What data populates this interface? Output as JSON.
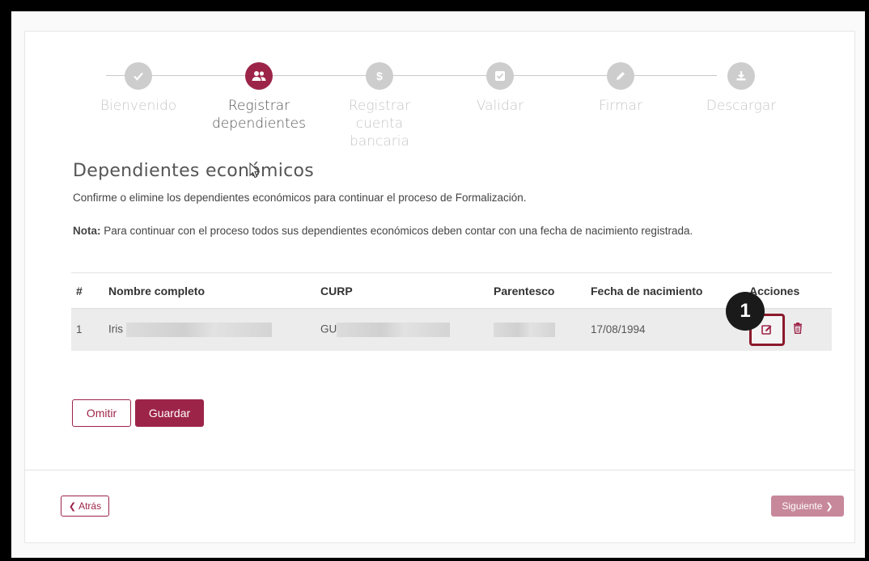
{
  "stepper": {
    "steps": [
      {
        "label": "Bienvenido",
        "icon": "check-icon"
      },
      {
        "label": "Registrar dependientes",
        "icon": "users-icon"
      },
      {
        "label": "Registrar cuenta bancaria",
        "icon": "dollar-icon"
      },
      {
        "label": "Validar",
        "icon": "check-square-icon"
      },
      {
        "label": "Firmar",
        "icon": "pencil-icon"
      },
      {
        "label": "Descargar",
        "icon": "download-icon"
      }
    ]
  },
  "section": {
    "title": "Dependientes económicos",
    "instructions": "Confirme o elimine los dependientes económicos para continuar el proceso de Formalización.",
    "note_label": "Nota:",
    "note_text": " Para continuar con el proceso todos sus dependientes económicos deben contar con una fecha de nacimiento registrada."
  },
  "table": {
    "headers": [
      "#",
      "Nombre completo",
      "CURP",
      "Parentesco",
      "Fecha de nacimiento",
      "Acciones"
    ],
    "rows": [
      {
        "index": "1",
        "name": "Iris",
        "curp": "GU",
        "parentesco": "",
        "fecha": "17/08/1994"
      }
    ]
  },
  "marker": "1",
  "buttons": {
    "omit": "Omitir",
    "save": "Guardar",
    "back": "Atrás",
    "next": "Siguiente"
  },
  "colors": {
    "accent": "#9d2449",
    "accent_light": "#c7889b",
    "inactive": "#cdcdcd"
  }
}
